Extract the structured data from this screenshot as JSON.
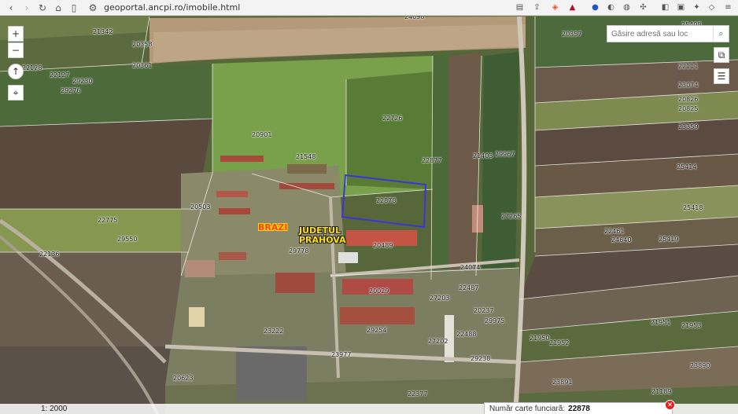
{
  "browser": {
    "url": "geoportal.ancpi.ro/imobile.html",
    "back_icon": "chevron-left-icon",
    "forward_icon": "chevron-right-icon",
    "reload_icon": "reload-icon",
    "home_icon": "home-icon",
    "bookmark_icon": "bookmark-icon",
    "site_info_icon": "site-info-icon"
  },
  "map_controls": {
    "zoom_in": "+",
    "zoom_out": "−",
    "north": "↑",
    "locate": "⌖"
  },
  "search": {
    "placeholder": "Găsire adresă sau loc"
  },
  "places": {
    "brazi": "BRAZI",
    "judetul_1": "JUDEȚUL",
    "judetul_2": "PRAHOVA"
  },
  "parcels": [
    "21342",
    "20358",
    "20357",
    "22128",
    "22127",
    "20361",
    "29230",
    "29276",
    "22111",
    "23074",
    "20826",
    "20825",
    "22726",
    "20901",
    "23359",
    "21548",
    "22877",
    "21403",
    "29967",
    "25414",
    "22878",
    "20503",
    "27265",
    "25418",
    "22775",
    "29550",
    "22461",
    "24640",
    "25419",
    "22136",
    "29778",
    "20489",
    "24074",
    "20029",
    "22487",
    "27203",
    "20237",
    "29975",
    "23222",
    "29254",
    "22488",
    "21951",
    "21953",
    "27202",
    "21950",
    "21952",
    "23977",
    "29238",
    "20623",
    "23890",
    "23891",
    "22377",
    "21189",
    "24698",
    "25408"
  ],
  "scale": {
    "label": "1: 2000"
  },
  "info": {
    "label": "Număr carte funciară:",
    "value": "22878"
  },
  "colors": {
    "selection_outline": "#3a35d6",
    "place_yellow": "#ffe000",
    "place_red": "#ff3b1f",
    "close_red": "#e02020"
  }
}
